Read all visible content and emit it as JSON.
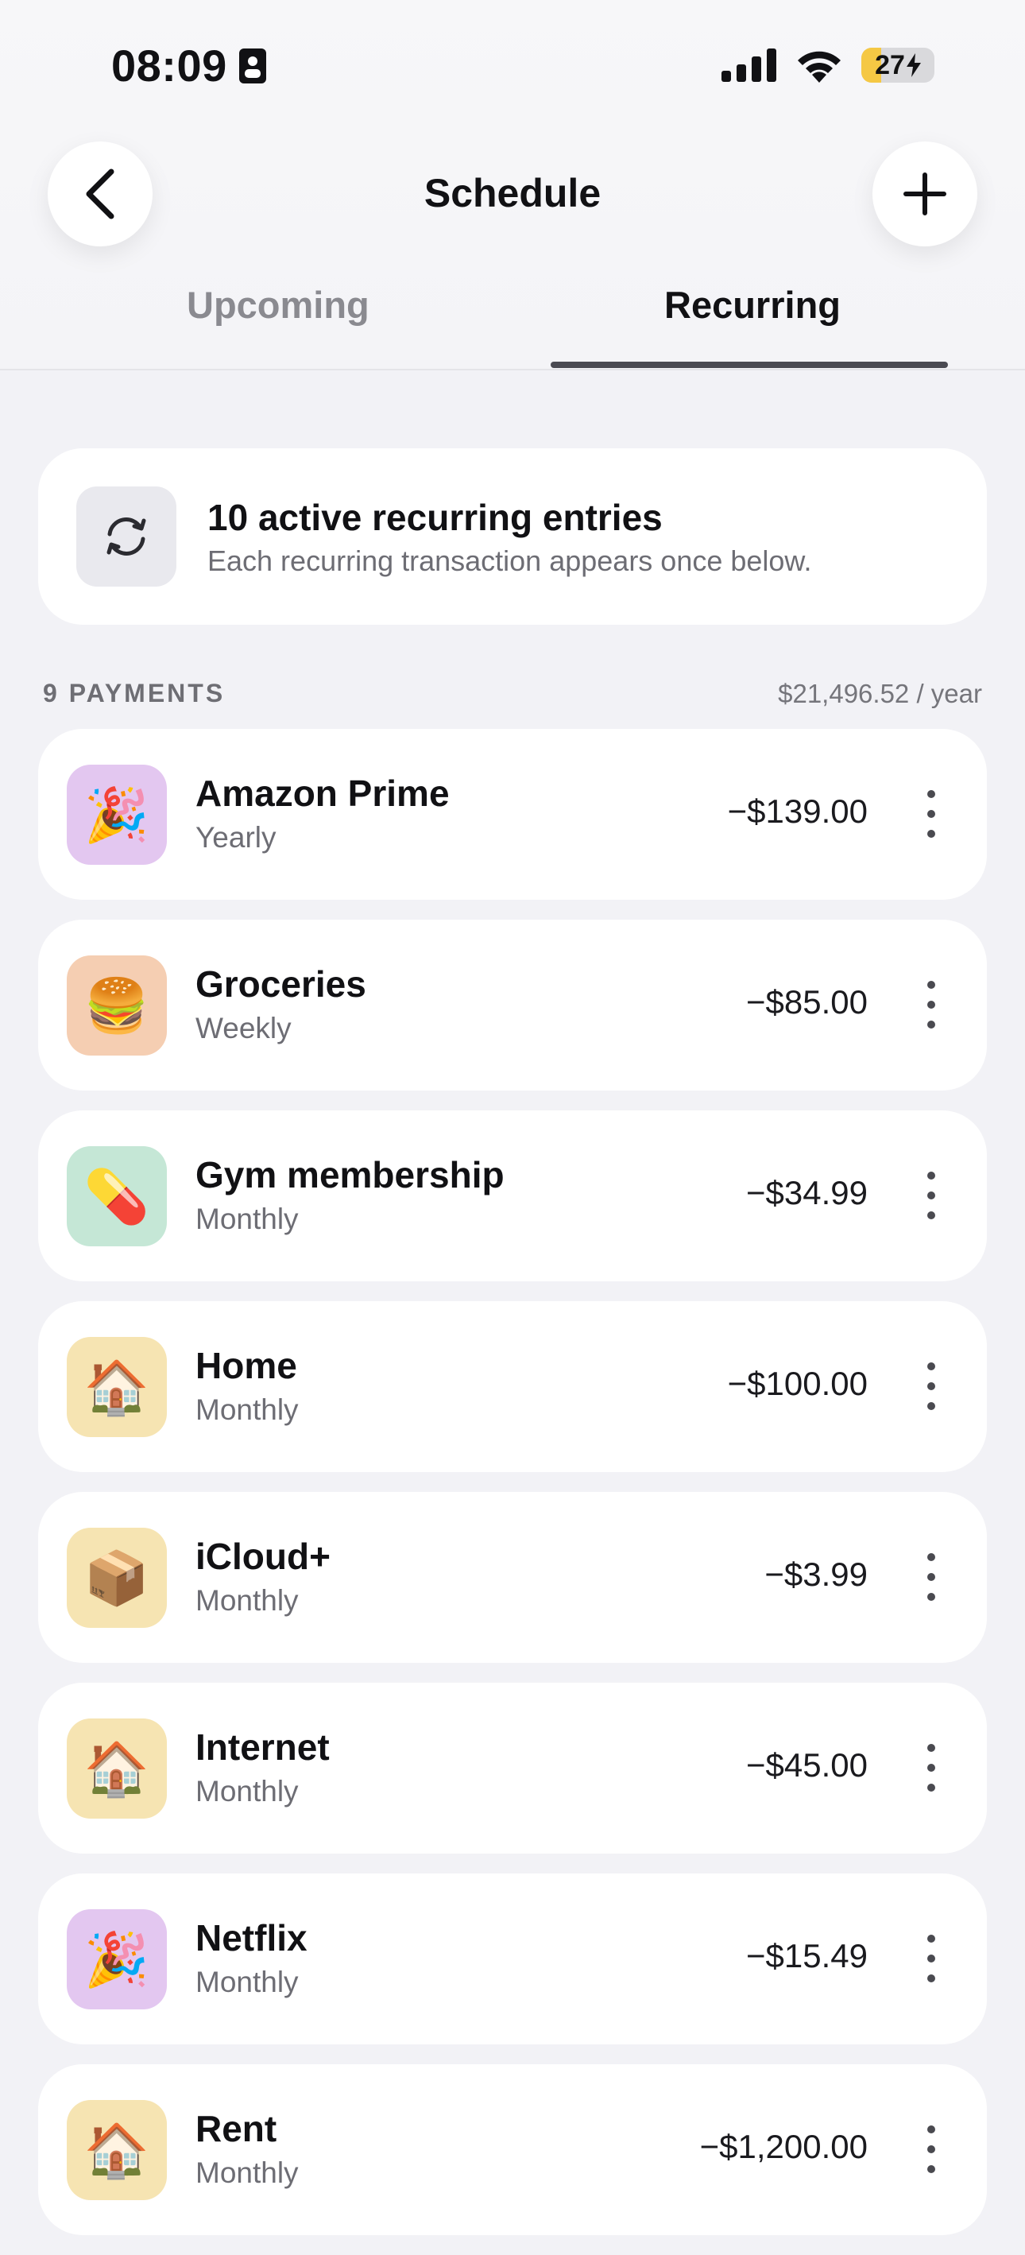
{
  "status_bar": {
    "time": "08:09",
    "battery_level": "27",
    "battery_fraction": 0.27,
    "battery_color": "#f5c844"
  },
  "header": {
    "title": "Schedule",
    "back_icon": "chevron-left-icon",
    "add_icon": "plus-icon"
  },
  "tabs": [
    {
      "label": "Upcoming",
      "active": false
    },
    {
      "label": "Recurring",
      "active": true
    }
  ],
  "summary": {
    "icon": "refresh-icon",
    "title": "10 active recurring entries",
    "subtitle": "Each recurring transaction appears once below."
  },
  "section": {
    "label": "9 PAYMENTS",
    "total": "$21,496.52 / year"
  },
  "payments": [
    {
      "name": "Amazon Prime",
      "frequency": "Yearly",
      "amount": "−$139.00",
      "emoji": "🎉",
      "bg": "#e3c7f0"
    },
    {
      "name": "Groceries",
      "frequency": "Weekly",
      "amount": "−$85.00",
      "emoji": "🍔",
      "bg": "#f5ceb2"
    },
    {
      "name": "Gym membership",
      "frequency": "Monthly",
      "amount": "−$34.99",
      "emoji": "💊",
      "bg": "#c5e7d6"
    },
    {
      "name": "Home",
      "frequency": "Monthly",
      "amount": "−$100.00",
      "emoji": "🏠",
      "bg": "#f6e4b2"
    },
    {
      "name": "iCloud+",
      "frequency": "Monthly",
      "amount": "−$3.99",
      "emoji": "📦",
      "bg": "#f6e4b2"
    },
    {
      "name": "Internet",
      "frequency": "Monthly",
      "amount": "−$45.00",
      "emoji": "🏠",
      "bg": "#f6e4b2"
    },
    {
      "name": "Netflix",
      "frequency": "Monthly",
      "amount": "−$15.49",
      "emoji": "🎉",
      "bg": "#e3c7f0"
    },
    {
      "name": "Rent",
      "frequency": "Monthly",
      "amount": "−$1,200.00",
      "emoji": "🏠",
      "bg": "#f6e4b2"
    }
  ]
}
